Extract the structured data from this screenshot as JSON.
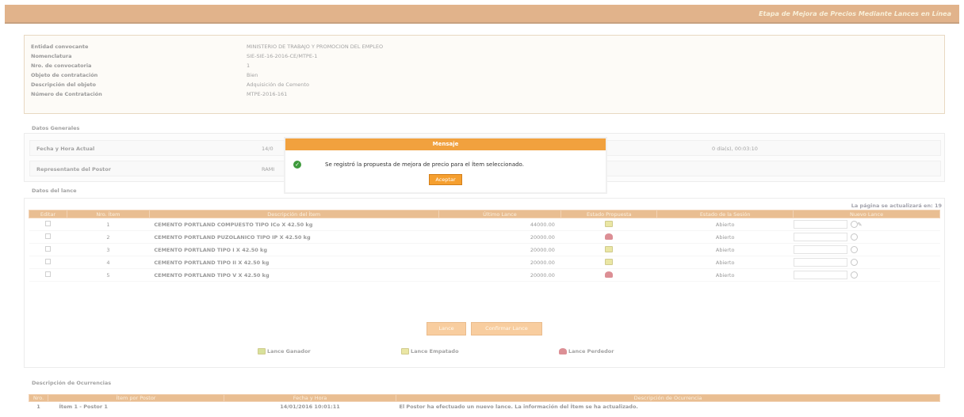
{
  "header": {
    "title": "Etapa de Mejora de Precios Mediante Lances en Línea"
  },
  "info": [
    {
      "label": "Entidad convocante",
      "value": "MINISTERIO DE TRABAJO Y PROMOCION DEL EMPLEO"
    },
    {
      "label": "Nomenclatura",
      "value": "SIE-SIE-16-2016-CE/MTPE-1"
    },
    {
      "label": "Nro. de convocatoria",
      "value": "1"
    },
    {
      "label": "Objeto de contratación",
      "value": "Bien"
    },
    {
      "label": "Descripción del objeto",
      "value": "Adquisición de Cemento"
    },
    {
      "label": "Número de Contratación",
      "value": "MTPE-2016-161"
    }
  ],
  "general": {
    "title": "Datos Generales",
    "fecha_label": "Fecha y Hora Actual",
    "fecha_value": "14/0",
    "tiempo_value": "0 día(s), 00:03:10",
    "rep_label": "Representante del Postor",
    "rep_value": "RAMI"
  },
  "items": {
    "title": "Datos del lance",
    "refresh_note": "La página se actualizará en: 19",
    "columns": [
      "Editar",
      "Nro. Ítem",
      "Descripción del Ítem",
      "Último Lance",
      "Estado Propuesta",
      "Estado de la Sesión",
      "Nuevo Lance"
    ],
    "rows": [
      {
        "item": "1",
        "desc": "CEMENTO PORTLAND COMPUESTO TIPO ICo X 42.50 kg",
        "lance": "44000.00",
        "flag": "yellow",
        "estado": "Abierto"
      },
      {
        "item": "2",
        "desc": "CEMENTO PORTLAND PUZOLANICO TIPO IP X 42.50 kg",
        "lance": "20000.00",
        "flag": "red",
        "estado": "Abierto"
      },
      {
        "item": "3",
        "desc": "CEMENTO PORTLAND TIPO I X 42.50 kg",
        "lance": "20000.00",
        "flag": "yellow",
        "estado": "Abierto"
      },
      {
        "item": "4",
        "desc": "CEMENTO PORTLAND TIPO II X 42.50 kg",
        "lance": "20000.00",
        "flag": "yellow",
        "estado": "Abierto"
      },
      {
        "item": "5",
        "desc": "CEMENTO PORTLAND TIPO V X 42.50 kg",
        "lance": "20000.00",
        "flag": "red",
        "estado": "Abierto"
      }
    ]
  },
  "buttons": {
    "lance": "Lance",
    "confirm": "Confirmar Lance"
  },
  "legend": {
    "ganador": "Lance Ganador",
    "empatado": "Lance Empatado",
    "perdedor": "Lance Perdedor"
  },
  "occurrences": {
    "title": "Descripción de Ocurrencias",
    "columns": [
      "Nro.",
      "Ítem por Postor",
      "Fecha y Hora",
      "Descripción de Ocurrencia"
    ],
    "rows": [
      {
        "nro": "1",
        "item": "Ítem 1 - Postor 1",
        "fecha": "14/01/2016 10:01:11",
        "desc": "El Postor ha efectuado un nuevo lance. La información del Ítem se ha actualizado."
      }
    ]
  },
  "modal": {
    "title": "Mensaje",
    "message": "Se registró la propuesta de mejora de precio para el Ítem seleccionado.",
    "accept": "Aceptar"
  },
  "colors": {
    "accent": "#d8893a",
    "modal_header": "#f1a13e",
    "ok": "#3e9a3c"
  }
}
